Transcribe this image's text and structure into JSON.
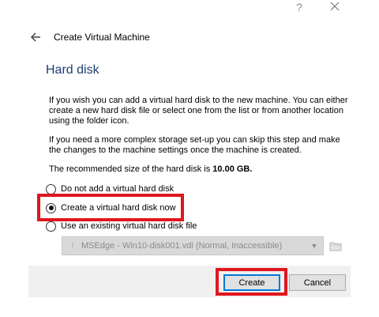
{
  "window": {
    "title": "Create Virtual Machine",
    "help_label": "?"
  },
  "page": {
    "heading": "Hard disk",
    "paragraph1": "If you wish you can add a virtual hard disk to the new machine. You can either create a new hard disk file or select one from the list or from another location using the folder icon.",
    "paragraph2": "If you need a more complex storage set-up you can skip this step and make the changes to the machine settings once the machine is created.",
    "recommended_prefix": "The recommended size of the hard disk is",
    "recommended_size": "10.00 GB."
  },
  "options": [
    {
      "label": "Do not add a virtual hard disk",
      "selected": false
    },
    {
      "label": "Create a virtual hard disk now",
      "selected": true
    },
    {
      "label": "Use an existing virtual hard disk file",
      "selected": false
    }
  ],
  "existing_disk": {
    "value": "MSEdge - Win10-disk001.vdi (Normal, Inaccessible)",
    "warn_glyph": "!",
    "chevron_glyph": "▼",
    "enabled": false
  },
  "buttons": {
    "create": "Create",
    "cancel": "Cancel"
  },
  "colors": {
    "heading": "#1e3d74",
    "highlight": "#e0161e",
    "default_button_border": "#0078d7",
    "footer_bg": "#f0f0f0"
  }
}
